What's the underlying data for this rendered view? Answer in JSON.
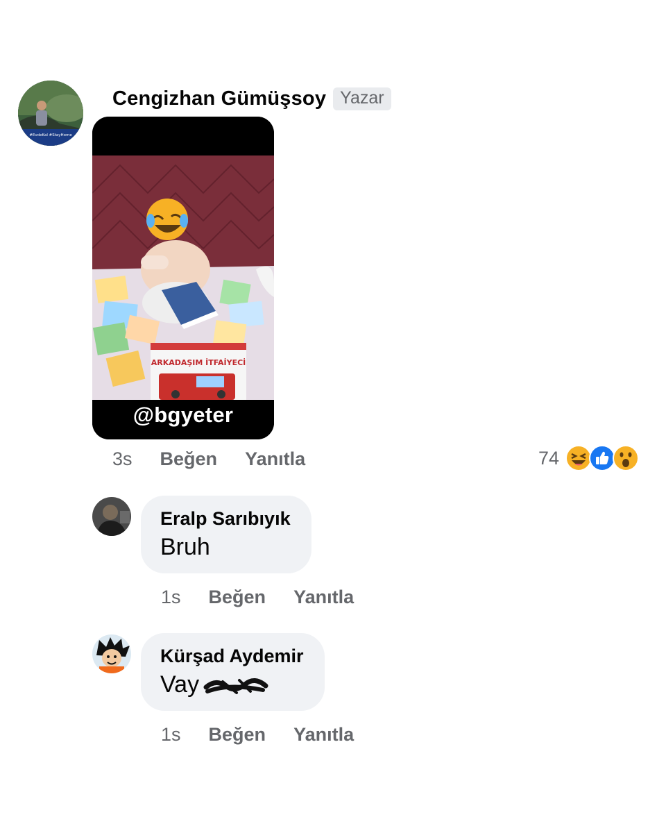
{
  "main_comment": {
    "author": "Cengizhan Gümüşsoy",
    "badge": "Yazar",
    "photo_caption": "@bgyeter",
    "book_title": "ARKADAŞIM İTFAİYECİ",
    "avatar_text": "#EvdeKal #StayHome",
    "time": "3s",
    "like_label": "Beğen",
    "reply_label": "Yanıtla",
    "reaction_count": "74",
    "reactions": [
      "haha-icon",
      "like-icon",
      "wow-icon"
    ]
  },
  "replies": [
    {
      "author": "Eralp Sarıbıyık",
      "text": "Bruh",
      "time": "1s",
      "like_label": "Beğen",
      "reply_label": "Yanıtla"
    },
    {
      "author": "Kürşad Aydemir",
      "text": "Vay",
      "time": "1s",
      "like_label": "Beğen",
      "reply_label": "Yanıtla"
    }
  ],
  "colors": {
    "secondary_text": "#65676b",
    "bubble_bg": "#f0f2f5",
    "badge_bg": "#e9ebee",
    "like_blue": "#1877f2",
    "reaction_yellow": "#f7b125"
  }
}
